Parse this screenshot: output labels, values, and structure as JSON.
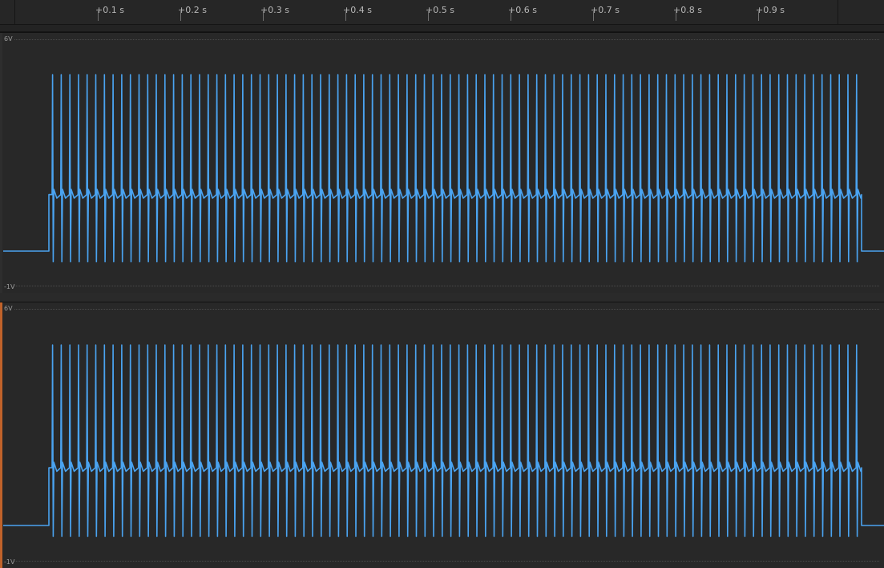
{
  "time_ruler": {
    "ticks": [
      "+0.1 s",
      "+0.2 s",
      "+0.3 s",
      "+0.4 s",
      "+0.5 s",
      "+0.6 s",
      "+0.7 s",
      "+0.8 s",
      "+0.9 s"
    ]
  },
  "channels": [
    {
      "id": "channel-1",
      "max_label": "6V",
      "min_label": "-1V",
      "active": false
    },
    {
      "id": "channel-2",
      "max_label": "6V",
      "min_label": "-1V",
      "active": true
    }
  ],
  "signal": {
    "color": "#4aa3f0",
    "idle_level_v": 0.0,
    "baseline_v": 1.6,
    "spike_high_v": 5.0,
    "spike_low_v": -0.3,
    "burst_start_s": 0.0,
    "burst_end_s": 1.012,
    "pulse_count": 94
  }
}
